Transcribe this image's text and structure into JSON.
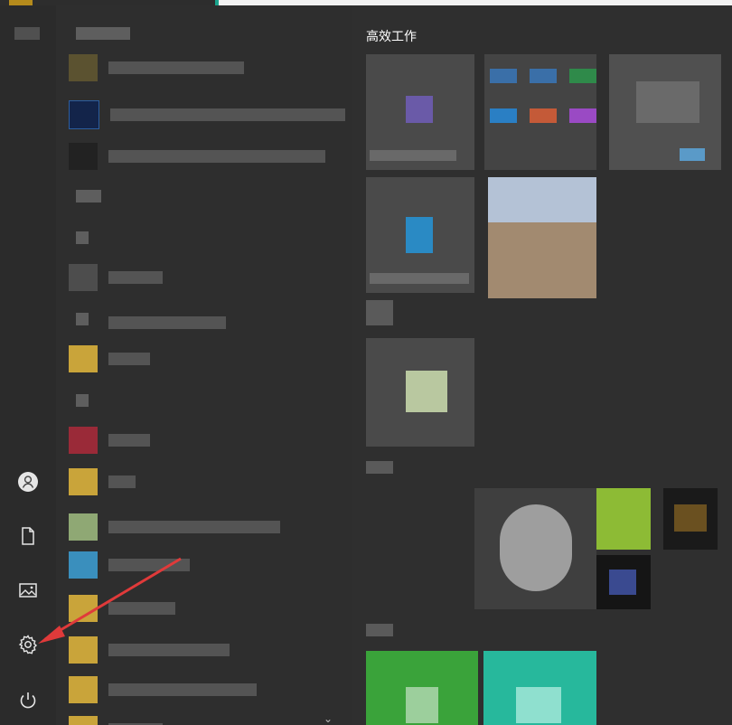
{
  "tiles_group": {
    "title": "高效工作"
  },
  "rail": {
    "icons": [
      "user-icon",
      "document-icon",
      "pictures-icon",
      "settings-icon",
      "power-icon"
    ]
  },
  "colors": {
    "arrow": "#e03a3a",
    "tile_green": "#3aa33a",
    "tile_teal": "#27b89c",
    "tile_lime": "#8dbb35"
  }
}
